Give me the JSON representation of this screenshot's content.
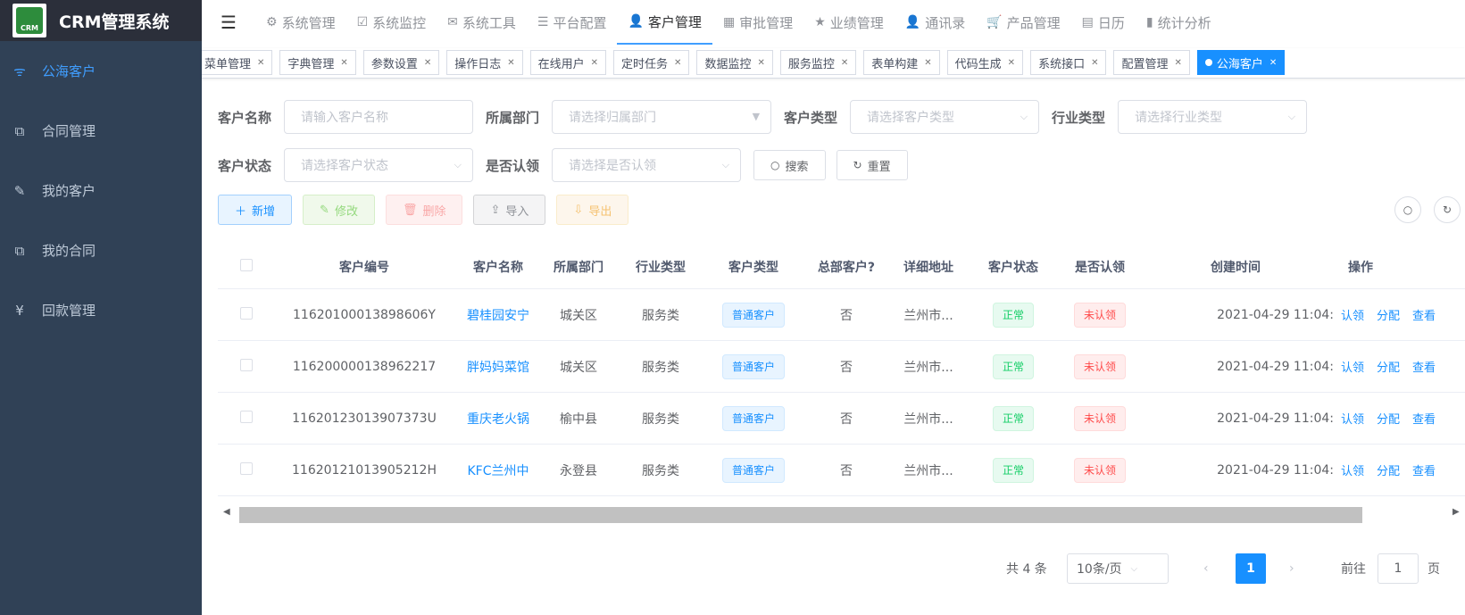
{
  "app": {
    "title": "CRM管理系统",
    "logo_text": "CRM"
  },
  "sidebar": {
    "items": [
      {
        "label": "公海客户",
        "icon": "org-chart-icon"
      },
      {
        "label": "合同管理",
        "icon": "copy-icon"
      },
      {
        "label": "我的客户",
        "icon": "edit-icon"
      },
      {
        "label": "我的合同",
        "icon": "copy-icon"
      },
      {
        "label": "回款管理",
        "icon": "yen-icon"
      }
    ]
  },
  "topnav": [
    {
      "label": "系统管理",
      "icon": "gear-icon"
    },
    {
      "label": "系统监控",
      "icon": "monitor-icon"
    },
    {
      "label": "系统工具",
      "icon": "tool-icon"
    },
    {
      "label": "平台配置",
      "icon": "list-icon"
    },
    {
      "label": "客户管理",
      "icon": "user-icon"
    },
    {
      "label": "审批管理",
      "icon": "grid-icon"
    },
    {
      "label": "业绩管理",
      "icon": "star-icon"
    },
    {
      "label": "通讯录",
      "icon": "user-icon"
    },
    {
      "label": "产品管理",
      "icon": "cart-icon"
    },
    {
      "label": "日历",
      "icon": "calendar-icon"
    },
    {
      "label": "统计分析",
      "icon": "chart-icon"
    }
  ],
  "tags": [
    "菜单管理",
    "字典管理",
    "参数设置",
    "操作日志",
    "在线用户",
    "定时任务",
    "数据监控",
    "服务监控",
    "表单构建",
    "代码生成",
    "系统接口",
    "配置管理",
    "公海客户"
  ],
  "filters": {
    "customer_name": {
      "label": "客户名称",
      "placeholder": "请输入客户名称"
    },
    "department": {
      "label": "所属部门",
      "placeholder": "请选择归属部门"
    },
    "customer_type": {
      "label": "客户类型",
      "placeholder": "请选择客户类型"
    },
    "industry_type": {
      "label": "行业类型",
      "placeholder": "请选择行业类型"
    },
    "customer_status": {
      "label": "客户状态",
      "placeholder": "请选择客户状态"
    },
    "claimed": {
      "label": "是否认领",
      "placeholder": "请选择是否认领"
    },
    "search_label": "搜索",
    "reset_label": "重置"
  },
  "toolbar": {
    "add": "新增",
    "edit": "修改",
    "delete": "删除",
    "import": "导入",
    "export": "导出"
  },
  "table": {
    "columns": [
      "客户编号",
      "客户名称",
      "所属部门",
      "行业类型",
      "客户类型",
      "总部客户?",
      "详细地址",
      "客户状态",
      "是否认领",
      "创建时间",
      "操作"
    ],
    "rows": [
      {
        "id": "11620100013898606Y",
        "name": "碧桂园安宁",
        "dept": "城关区",
        "industry": "服务类",
        "type": "普通客户",
        "hq": "否",
        "address": "兰州市...",
        "status": "正常",
        "claimed": "未认领",
        "created": "2021-04-29 11:04:"
      },
      {
        "id": "116200000138962217",
        "name": "胖妈妈菜馆",
        "dept": "城关区",
        "industry": "服务类",
        "type": "普通客户",
        "hq": "否",
        "address": "兰州市...",
        "status": "正常",
        "claimed": "未认领",
        "created": "2021-04-29 11:04:"
      },
      {
        "id": "11620123013907373U",
        "name": "重庆老火锅",
        "dept": "榆中县",
        "industry": "服务类",
        "type": "普通客户",
        "hq": "否",
        "address": "兰州市...",
        "status": "正常",
        "claimed": "未认领",
        "created": "2021-04-29 11:04:"
      },
      {
        "id": "11620121013905212H",
        "name": "KFC兰州中",
        "dept": "永登县",
        "industry": "服务类",
        "type": "普通客户",
        "hq": "否",
        "address": "兰州市...",
        "status": "正常",
        "claimed": "未认领",
        "created": "2021-04-29 11:04:"
      }
    ],
    "ops": [
      "认领",
      "分配",
      "查看"
    ]
  },
  "pagination": {
    "total": "共 4 条",
    "page_size": "10条/页",
    "current": "1",
    "goto_label": "前往",
    "goto_value": "1",
    "page_suffix": "页"
  },
  "colors": {
    "sidebar_bg": "#304156",
    "accent": "#1890ff"
  }
}
